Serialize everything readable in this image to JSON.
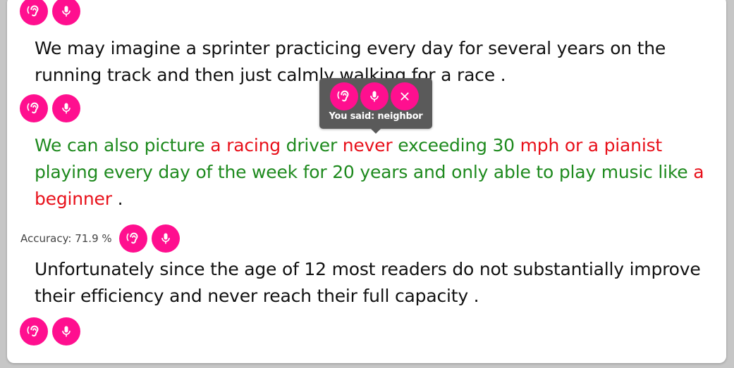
{
  "colors": {
    "accent": "#ff0f8f",
    "correct": "#1e8a1e",
    "incorrect": "#e8101a",
    "tooltip_bg": "#5a5a5a"
  },
  "icons": {
    "listen": "ear-icon",
    "record": "microphone-icon",
    "close": "close-icon"
  },
  "paragraphs": [
    {
      "text": "We may imagine a sprinter practicing every day for several years on the running track and then just calmly walking for a race ."
    },
    {
      "segments": [
        {
          "text": "We can also picture ",
          "status": "correct"
        },
        {
          "text": "a racing",
          "status": "incorrect"
        },
        {
          "text": " driver ",
          "status": "correct"
        },
        {
          "text": "never",
          "status": "incorrect"
        },
        {
          "text": " exceeding 30 ",
          "status": "correct"
        },
        {
          "text": "mph or a pianist",
          "status": "incorrect"
        },
        {
          "text": " playing every day of the week for 20 years and only able to play music like ",
          "status": "correct"
        },
        {
          "text": "a beginner",
          "status": "incorrect"
        },
        {
          "text": " .",
          "status": "plain"
        }
      ],
      "accuracy_label": "Accuracy: 71.9 %"
    },
    {
      "text": "Unfortunately since the age of 12 most readers do not substantially improve their efficiency and never reach their full capacity ."
    }
  ],
  "tooltip": {
    "text": "You said: neighbor"
  }
}
